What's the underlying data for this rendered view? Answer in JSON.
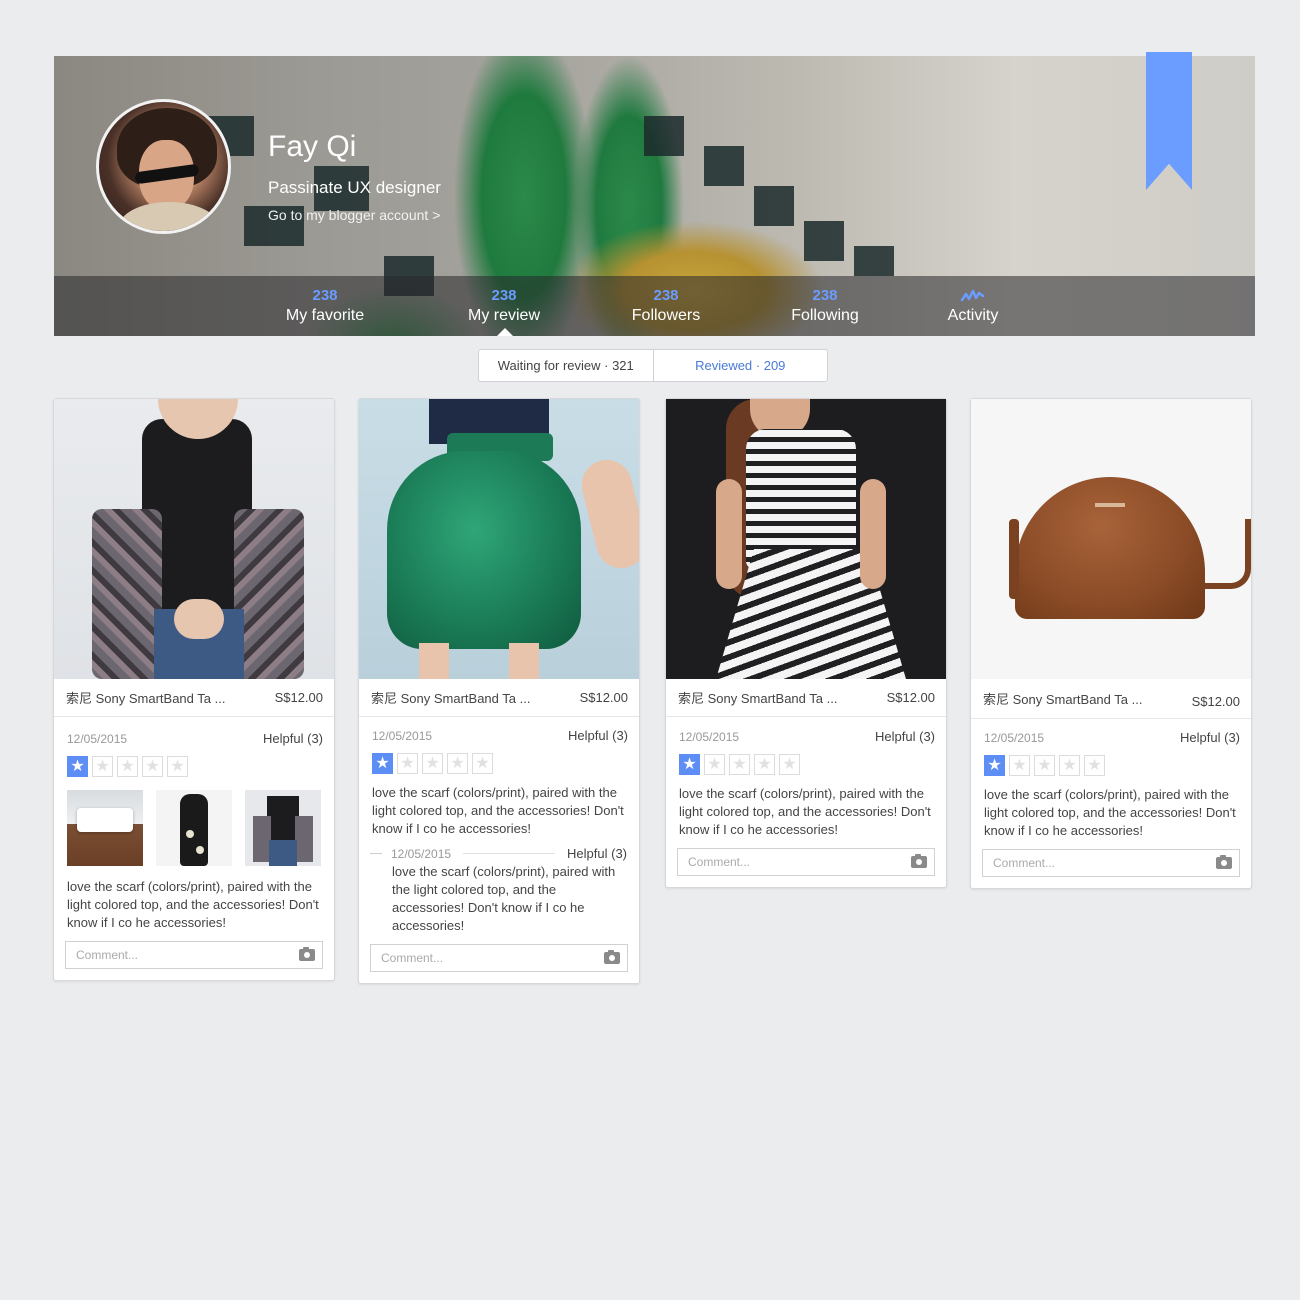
{
  "profile": {
    "name": "Fay Qi",
    "title": "Passinate UX designer",
    "blogger_link": "Go to my blogger account >"
  },
  "stats": [
    {
      "count": "238",
      "label": "My favorite"
    },
    {
      "count": "238",
      "label": "My review"
    },
    {
      "count": "238",
      "label": "Followers"
    },
    {
      "count": "238",
      "label": "Following"
    },
    {
      "icon": "activity-icon",
      "label": "Activity"
    }
  ],
  "tabs": {
    "waiting": "Waiting for review · 321",
    "reviewed": "Reviewed · 209"
  },
  "colors": {
    "accent": "#6b9cff",
    "star_on": "#5d8ef5",
    "link": "#4a7bd8"
  },
  "cards": [
    {
      "product": "索尼 Sony SmartBand Ta ...",
      "price": "S$12.00",
      "date": "12/05/2015",
      "helpful": "Helpful (3)",
      "rating": 1,
      "review": "love the scarf (colors/print), paired with the light colored top, and the accessories! Don't know if I co he accessories!",
      "comment_placeholder": "Comment..."
    },
    {
      "product": "索尼 Sony SmartBand Ta ...",
      "price": "S$12.00",
      "date": "12/05/2015",
      "helpful": "Helpful (3)",
      "rating": 1,
      "review": "love the scarf (colors/print), paired with the light colored top, and the accessories! Don't know if I co he accessories!",
      "reply_date": "12/05/2015",
      "reply_helpful": "Helpful (3)",
      "reply_text": "love the scarf (colors/print), paired with the light colored top, and the accessories! Don't know if I co he accessories!",
      "comment_placeholder": "Comment..."
    },
    {
      "product": "索尼 Sony SmartBand Ta ...",
      "price": "S$12.00",
      "date": "12/05/2015",
      "helpful": "Helpful (3)",
      "rating": 1,
      "review": "love the scarf (colors/print), paired with the light colored top, and the accessories! Don't know if I co he accessories!",
      "comment_placeholder": "Comment..."
    },
    {
      "product": "索尼 Sony SmartBand Ta ...",
      "price": "S$12.00",
      "date": "12/05/2015",
      "helpful": "Helpful (3)",
      "rating": 1,
      "review": "love the scarf (colors/print), paired with the light colored top, and the accessories! Don't know if I co he accessories!",
      "comment_placeholder": "Comment..."
    }
  ]
}
